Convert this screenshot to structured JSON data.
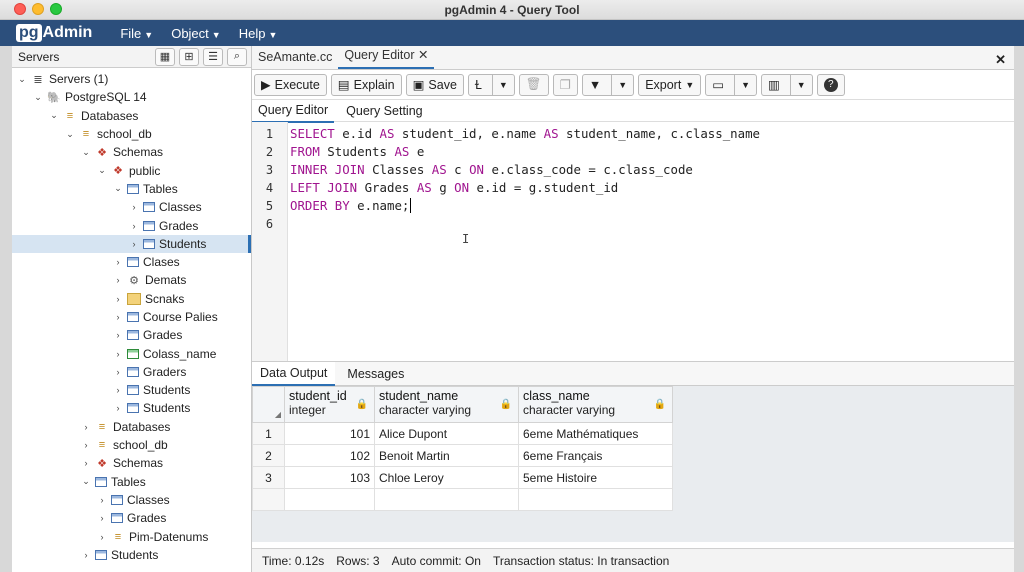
{
  "window": {
    "title": "pgAdmin 4 - Query Tool"
  },
  "app": {
    "logo_pg": "pg",
    "logo_admin": "Admin",
    "menu": [
      "File",
      "Object",
      "Help"
    ]
  },
  "browser": {
    "title": "Servers",
    "tree": [
      {
        "label": "Servers (1)",
        "icon": "server-icon",
        "depth": 0,
        "chevron": "down"
      },
      {
        "label": "PostgreSQL 14",
        "icon": "elephant-icon",
        "depth": 1,
        "chevron": "down"
      },
      {
        "label": "Databases",
        "icon": "database-icon",
        "depth": 2,
        "chevron": "down"
      },
      {
        "label": "school_db",
        "icon": "database-icon",
        "depth": 3,
        "chevron": "down"
      },
      {
        "label": "Schemas",
        "icon": "schema-icon",
        "depth": 4,
        "chevron": "down"
      },
      {
        "label": "public",
        "icon": "schema-icon",
        "depth": 5,
        "chevron": "down"
      },
      {
        "label": "Tables",
        "icon": "tables-icon",
        "depth": 6,
        "chevron": "down"
      },
      {
        "label": "Classes",
        "icon": "table-icon",
        "depth": 7,
        "chevron": "right"
      },
      {
        "label": "Grades",
        "icon": "table-icon",
        "depth": 7,
        "chevron": "right"
      },
      {
        "label": "Students",
        "icon": "table-icon",
        "depth": 7,
        "chevron": "right",
        "selected": true
      },
      {
        "label": "Clases",
        "icon": "tables-icon",
        "depth": 6,
        "chevron": "right"
      },
      {
        "label": "Demats",
        "icon": "gear-icon",
        "depth": 6,
        "chevron": "right"
      },
      {
        "label": "Scnaks",
        "icon": "folder-icon",
        "depth": 6,
        "chevron": "right"
      },
      {
        "label": "Course Palies",
        "icon": "tables-icon",
        "depth": 6,
        "chevron": "right"
      },
      {
        "label": "Grades",
        "icon": "table-icon",
        "depth": 6,
        "chevron": "right"
      },
      {
        "label": "Colass_name",
        "icon": "green-table-icon",
        "depth": 6,
        "chevron": "right"
      },
      {
        "label": "Graders",
        "icon": "table-icon",
        "depth": 6,
        "chevron": "right"
      },
      {
        "label": "Students",
        "icon": "table-icon",
        "depth": 6,
        "chevron": "right"
      },
      {
        "label": "Students",
        "icon": "table-icon",
        "depth": 6,
        "chevron": "right"
      },
      {
        "label": "Databases",
        "icon": "database-icon",
        "depth": 4,
        "chevron": "right"
      },
      {
        "label": "school_db",
        "icon": "database-icon",
        "depth": 4,
        "chevron": "right"
      },
      {
        "label": "Schemas",
        "icon": "schema-icon",
        "depth": 4,
        "chevron": "right"
      },
      {
        "label": "Tables",
        "icon": "tables-icon",
        "depth": 4,
        "chevron": "down"
      },
      {
        "label": "Classes",
        "icon": "tables-icon",
        "depth": 5,
        "chevron": "right"
      },
      {
        "label": "Grades",
        "icon": "tables-icon",
        "depth": 5,
        "chevron": "right"
      },
      {
        "label": "Pim-Datenums",
        "icon": "database-icon",
        "depth": 5,
        "chevron": "right"
      },
      {
        "label": "Students",
        "icon": "table-icon",
        "depth": 4,
        "chevron": "right"
      }
    ]
  },
  "tabs": [
    {
      "label": "SeAmante.cc",
      "active": false
    },
    {
      "label": "Query Editor",
      "active": true,
      "closable": true
    }
  ],
  "toolbar": {
    "execute": "Execute",
    "explain": "Explain",
    "save": "Save",
    "export": "Export"
  },
  "subtabs": [
    "Query Editor",
    "Query Setting"
  ],
  "editor": {
    "line_numbers": [
      "1",
      "2",
      "3",
      "4",
      "5",
      "6"
    ],
    "lines": [
      [
        {
          "k": "SELECT"
        },
        {
          "t": " e.id "
        },
        {
          "k": "AS"
        },
        {
          "t": " student_id, e.name "
        },
        {
          "k": "AS"
        },
        {
          "t": " student_name, c.class_name"
        }
      ],
      [
        {
          "k": "FROM"
        },
        {
          "t": " Students "
        },
        {
          "k": "AS"
        },
        {
          "t": " e"
        }
      ],
      [
        {
          "k": "INNER JOIN"
        },
        {
          "t": " Classes "
        },
        {
          "k": "AS"
        },
        {
          "t": " c "
        },
        {
          "k": "ON"
        },
        {
          "t": " e.class_code = c.class_code"
        }
      ],
      [
        {
          "k": "LEFT JOIN"
        },
        {
          "t": " Grades "
        },
        {
          "k": "AS"
        },
        {
          "t": " g "
        },
        {
          "k": "ON"
        },
        {
          "t": " e.id = g.student_id"
        }
      ],
      [
        {
          "k": "ORDER BY"
        },
        {
          "t": " e.name;"
        }
      ],
      []
    ]
  },
  "output_tabs": [
    "Data Output",
    "Messages"
  ],
  "grid": {
    "columns": [
      {
        "name": "student_id",
        "type": "integer"
      },
      {
        "name": "student_name",
        "type": "character varying"
      },
      {
        "name": "class_name",
        "type": "character varying"
      }
    ],
    "rows": [
      {
        "n": "1",
        "student_id": "101",
        "student_name": "Alice Dupont",
        "class_name": "6eme Mathématiques"
      },
      {
        "n": "2",
        "student_id": "102",
        "student_name": "Benoit Martin",
        "class_name": "6eme Français"
      },
      {
        "n": "3",
        "student_id": "103",
        "student_name": "Chloe Leroy",
        "class_name": "5eme Histoire"
      }
    ]
  },
  "status": {
    "time": "Time: 0.12s",
    "rows": "Rows: 3",
    "autocommit": "Auto commit: On",
    "transaction": "Transaction status: In transaction"
  },
  "colors": {
    "brand": "#2c4f7c",
    "keyword": "#a0148f",
    "accent": "#2c6fb3"
  }
}
